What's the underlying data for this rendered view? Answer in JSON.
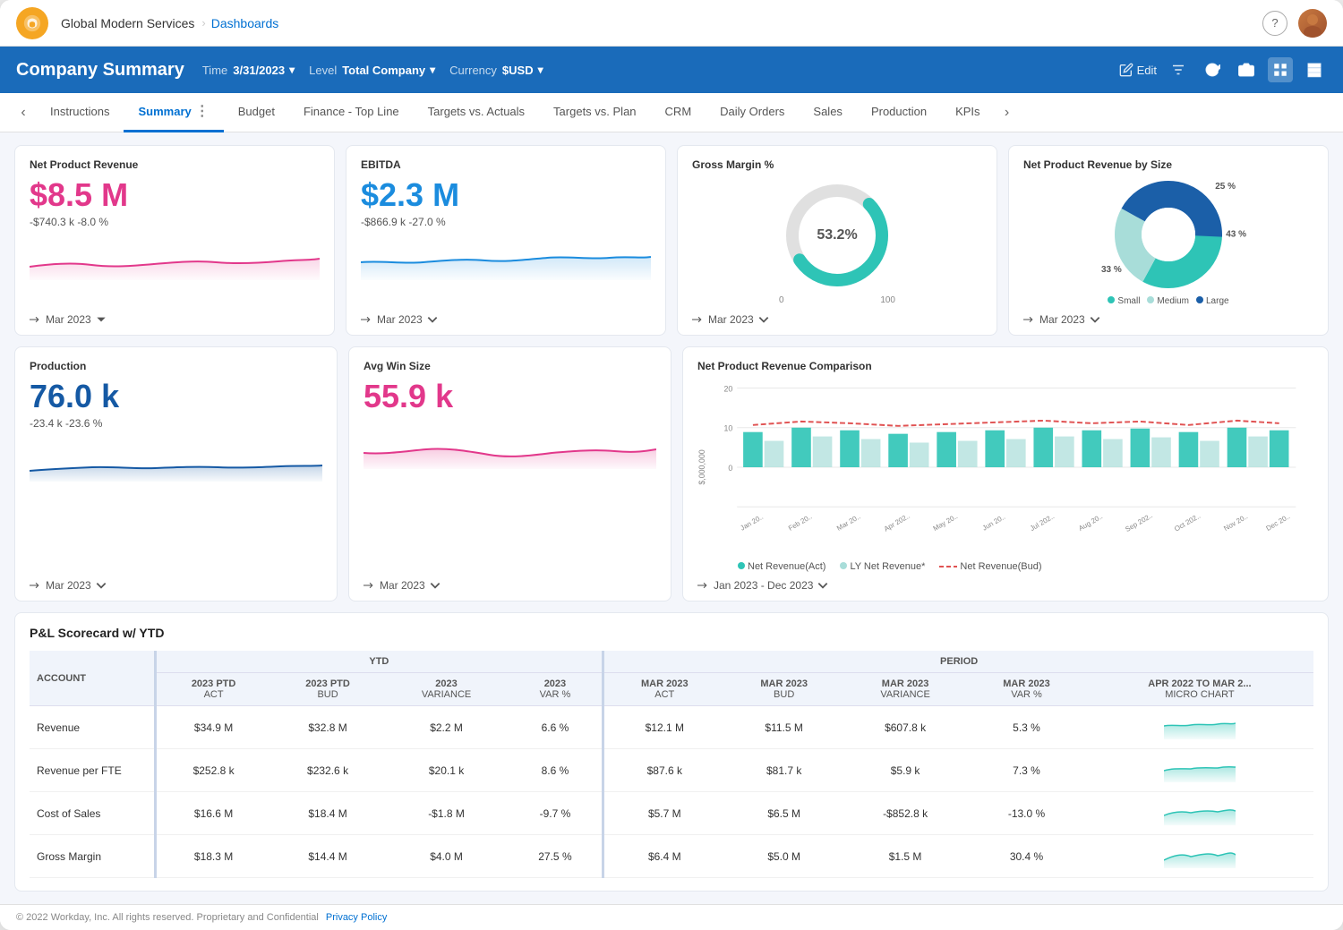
{
  "app": {
    "company": "Global Modern Services",
    "nav_link": "Dashboards",
    "help_icon": "?",
    "edit_label": "Edit"
  },
  "header": {
    "title": "Company Summary",
    "time_label": "Time",
    "time_value": "3/31/2023",
    "level_label": "Level",
    "level_value": "Total Company",
    "currency_label": "Currency",
    "currency_value": "$USD"
  },
  "tabs": {
    "prev_label": "‹",
    "next_label": "›",
    "items": [
      {
        "label": "Instructions",
        "active": false
      },
      {
        "label": "Summary",
        "active": true
      },
      {
        "label": "Budget",
        "active": false
      },
      {
        "label": "Finance - Top Line",
        "active": false
      },
      {
        "label": "Targets vs. Actuals",
        "active": false
      },
      {
        "label": "Targets vs. Plan",
        "active": false
      },
      {
        "label": "CRM",
        "active": false
      },
      {
        "label": "Daily Orders",
        "active": false
      },
      {
        "label": "Sales",
        "active": false
      },
      {
        "label": "Production",
        "active": false
      },
      {
        "label": "KPIs",
        "active": false
      }
    ]
  },
  "cards": {
    "net_product_revenue": {
      "title": "Net Product Revenue",
      "value": "$8.5 M",
      "delta": "-$740.3 k  -8.0 %",
      "period": "Mar 2023"
    },
    "ebitda": {
      "title": "EBITDA",
      "value": "$2.3 M",
      "delta": "-$866.9 k  -27.0 %",
      "period": "Mar 2023"
    },
    "gross_margin": {
      "title": "Gross Margin %",
      "value": "53.2%",
      "axis_min": "0",
      "axis_max": "100",
      "period": "Mar 2023"
    },
    "net_rev_by_size": {
      "title": "Net Product Revenue by Size",
      "pct_small": "33 %",
      "pct_medium": "25 %",
      "pct_large": "43 %",
      "legend_small": "Small",
      "legend_medium": "Medium",
      "legend_large": "Large",
      "period": "Mar 2023"
    },
    "production": {
      "title": "Production",
      "value": "76.0 k",
      "delta": "-23.4 k  -23.6 %",
      "period": "Mar 2023"
    },
    "avg_win_size": {
      "title": "Avg Win Size",
      "value": "55.9 k",
      "delta": "",
      "period": "Mar 2023"
    },
    "net_rev_comparison": {
      "title": "Net Product Revenue Comparison",
      "y_label": "$,000,000",
      "y_max": "20",
      "y_mid": "10",
      "period": "Jan 2023 - Dec 2023",
      "legend_act": "Net Revenue(Act)",
      "legend_ly": "LY Net Revenue*",
      "legend_bud": "Net Revenue(Bud)",
      "months": [
        "Jan 20..",
        "Feb 20..",
        "Mar 20..",
        "Apr 202..",
        "May 20..",
        "Jun 20..",
        "Jul 202..",
        "Aug 20..",
        "Sep 202..",
        "Oct 202..",
        "Nov 20..",
        "Dec 20.."
      ]
    }
  },
  "scorecard": {
    "title": "P&L Scorecard w/ YTD",
    "columns": {
      "account": "ACCOUNT",
      "ytd_act": "2023 PTD\nACT",
      "ytd_bud": "2023 PTD\nBUD",
      "ytd_var": "2023\nVARIANCE",
      "ytd_varp": "2023\nVAR %",
      "mar_act": "MAR 2023\nACT",
      "mar_bud": "MAR 2023\nBUD",
      "mar_var": "MAR 2023\nVARIANCE",
      "mar_varp": "MAR 2023\nVAR %",
      "micro": "APR 2022 TO MAR 2...\nMICRO CHART"
    },
    "rows": [
      {
        "account": "Revenue",
        "ytd_act": "$34.9 M",
        "ytd_bud": "$32.8 M",
        "ytd_var": "$2.2 M",
        "ytd_varp": "6.6 %",
        "mar_act": "$12.1 M",
        "mar_bud": "$11.5 M",
        "mar_var": "$607.8 k",
        "mar_varp": "5.3 %",
        "micro": true
      },
      {
        "account": "Revenue per FTE",
        "ytd_act": "$252.8 k",
        "ytd_bud": "$232.6 k",
        "ytd_var": "$20.1 k",
        "ytd_varp": "8.6 %",
        "mar_act": "$87.6 k",
        "mar_bud": "$81.7 k",
        "mar_var": "$5.9 k",
        "mar_varp": "7.3 %",
        "micro": true
      },
      {
        "account": "Cost of Sales",
        "ytd_act": "$16.6 M",
        "ytd_bud": "$18.4 M",
        "ytd_var": "-$1.8 M",
        "ytd_varp": "-9.7 %",
        "mar_act": "$5.7 M",
        "mar_bud": "$6.5 M",
        "mar_var": "-$852.8 k",
        "mar_varp": "-13.0 %",
        "micro": true
      },
      {
        "account": "Gross Margin",
        "ytd_act": "$18.3 M",
        "ytd_bud": "$14.4 M",
        "ytd_var": "$4.0 M",
        "ytd_varp": "27.5 %",
        "mar_act": "$6.4 M",
        "mar_bud": "$5.0 M",
        "mar_var": "$1.5 M",
        "mar_varp": "30.4 %",
        "micro": true
      }
    ]
  },
  "footer": {
    "copyright": "© 2022 Workday, Inc. All rights reserved. Proprietary and Confidential",
    "privacy_link": "Privacy Policy"
  }
}
